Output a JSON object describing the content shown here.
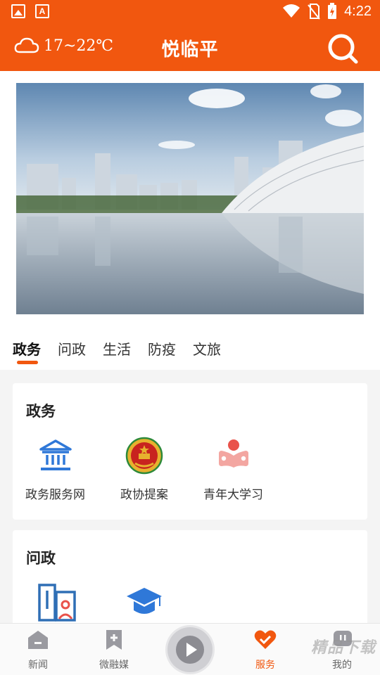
{
  "status_bar": {
    "time": "4:22"
  },
  "header": {
    "weather": "17~22℃",
    "title": "悦临平"
  },
  "tabs": [
    {
      "label": "政务",
      "active": true
    },
    {
      "label": "问政"
    },
    {
      "label": "生活"
    },
    {
      "label": "防疫"
    },
    {
      "label": "文旅"
    }
  ],
  "sections": [
    {
      "title": "政务",
      "items": [
        {
          "label": "政务服务网",
          "icon": "government-building-icon"
        },
        {
          "label": "政协提案",
          "icon": "cppcc-emblem-icon"
        },
        {
          "label": "青年大学习",
          "icon": "youth-study-icon"
        }
      ]
    },
    {
      "title": "问政",
      "items": [
        {
          "label": "",
          "icon": "id-card-icon"
        },
        {
          "label": "",
          "icon": "graduation-cap-icon"
        }
      ]
    }
  ],
  "bottom_nav": [
    {
      "label": "新闻",
      "icon": "home-icon"
    },
    {
      "label": "微融媒",
      "icon": "bookmark-icon"
    },
    {
      "label": "",
      "icon": "play-icon"
    },
    {
      "label": "服务",
      "icon": "heart-icon",
      "active": true
    },
    {
      "label": "我的",
      "icon": "chat-icon"
    }
  ],
  "watermark": "精品下载",
  "colors": {
    "accent": "#f1570f",
    "blue": "#2f78d8",
    "red": "#e9524a"
  }
}
